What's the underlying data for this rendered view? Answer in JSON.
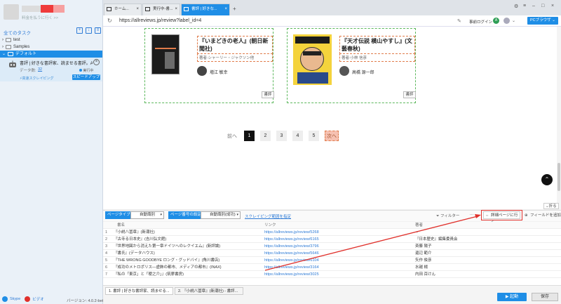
{
  "left_panel": {
    "user_sub": "料金を払うに行く >>",
    "all_tasks": "全てのタスク",
    "tree": [
      {
        "label": "test"
      },
      {
        "label": "Samples"
      },
      {
        "label": "デフォルト"
      }
    ],
    "task": {
      "title": "書評 | 好きな書評家、読ませる書評。ALL...",
      "count_label": "データ数:",
      "count": "32",
      "status": "実行中",
      "speed_label": "高速スクレイピング",
      "speed_button": "スピードアップ"
    },
    "footer": {
      "skype": "Skype",
      "video": "ビデオ",
      "version": "バージョン: 4.0.2-beta.2"
    }
  },
  "browser": {
    "tabs": [
      {
        "label": "ホーム..."
      },
      {
        "label": "実行中-書..."
      },
      {
        "label": "書評 | 好きな..."
      }
    ],
    "url": "https://allreviews.jp/review?label_id=4",
    "login": "事前ログイン",
    "pc_browser": "PCブラウザ"
  },
  "books": [
    {
      "title": "『いまどきの老人』(朝日新聞社)",
      "author": "著者:シャーリー・ジャクソン他",
      "reviewer": "増江 敏幸",
      "button": "書評"
    },
    {
      "title": "『天才伝説 横山やすし』(文藝春秋)",
      "author": "著者:小林 信彦",
      "reviewer": "高橋 源一郎",
      "button": "書評"
    }
  ],
  "pager": {
    "prev": "前へ",
    "pages": [
      "1",
      "2",
      "3",
      "4",
      "5"
    ],
    "current": "1",
    "next": "次へ"
  },
  "panel": {
    "collapse": "折る",
    "page_type_label": "ページタイプ",
    "page_type_value": "自動識別",
    "page_num_label": "ページ番号の設定",
    "page_num_value": "自動識別(成功)",
    "scrape_link": "スクレイピング範囲を指定",
    "filter": "フィルター",
    "goto_detail": "詳細ページに行く",
    "add_field": "フィールドを追加",
    "headers": [
      "書名",
      "リンク",
      "著者"
    ],
    "rows": [
      {
        "n": "1",
        "title": "『小説八冨章』(新潮社)",
        "link": "https://allreviews.jp/review/5268",
        "author": "--"
      },
      {
        "n": "2",
        "title": "『古寺る日本史』(吉川弘文館)",
        "link": "https://allreviews.jp/review/6165",
        "author": "『日本歴史』編集委員会"
      },
      {
        "n": "3",
        "title": "『世界地図から消えた第一章ドイツへのレクイエム』(新評論)",
        "link": "https://allreviews.jp/review/3796",
        "author": "斉藤 陽子"
      },
      {
        "n": "4",
        "title": "『書氏』(データハウス)",
        "link": "https://allreviews.jp/review/5646",
        "author": "還辺 範介"
      },
      {
        "n": "5",
        "title": "『THE WRONG GOODBYE ロング・グッドバイ』(角川書店)",
        "link": "https://allreviews.jp/review/6104",
        "author": "矢作 俊彦"
      },
      {
        "n": "6",
        "title": "『成功のメトロポリス―虚飾の都市、メディアの都市』(INAX)",
        "link": "https://allreviews.jp/review/3164",
        "author": "水越 楊"
      },
      {
        "n": "7",
        "title": "『私の「東京」と「曖之介」』(筑摩書房)",
        "link": "https://allreviews.jp/review/3025",
        "author": "内田 百けん"
      }
    ]
  },
  "bottom": {
    "tabs": [
      "1. 書評 | 好きな書評家、読ませる...",
      "2. 『小説八冨章』(新潮社) - 書評..."
    ],
    "run": "起動",
    "save": "保存"
  },
  "colors": {
    "accent": "#1f8ee6",
    "highlight": "#e0302b",
    "card_border": "#5cb85c"
  }
}
